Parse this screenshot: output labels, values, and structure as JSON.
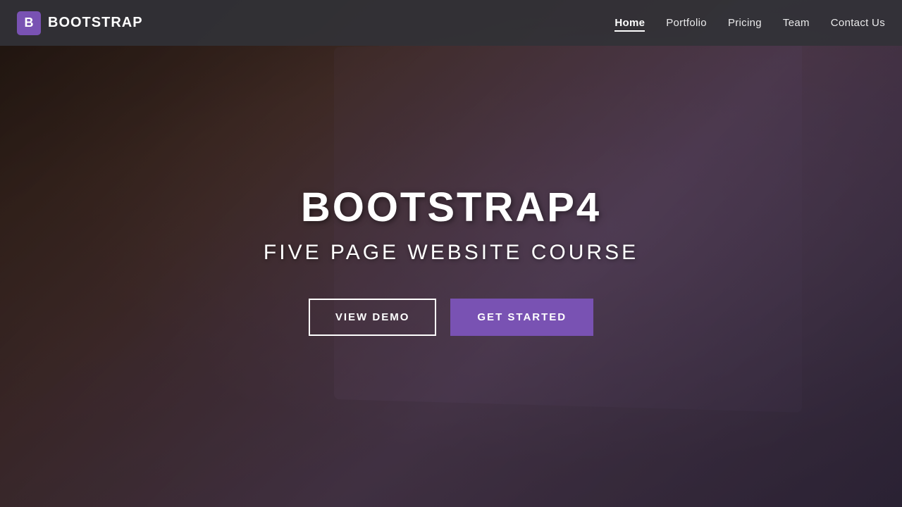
{
  "brand": {
    "icon_text": "B",
    "name": "BOOTSTRAP"
  },
  "nav": {
    "links": [
      {
        "label": "Home",
        "active": true
      },
      {
        "label": "Portfolio",
        "active": false
      },
      {
        "label": "Pricing",
        "active": false
      },
      {
        "label": "Team",
        "active": false
      },
      {
        "label": "Contact Us",
        "active": false
      }
    ]
  },
  "hero": {
    "title": "BOOTSTRAP4",
    "subtitle": "FIVE PAGE WEBSITE COURSE",
    "btn_demo": "VIEW DEMO",
    "btn_start": "GET STARTED"
  }
}
